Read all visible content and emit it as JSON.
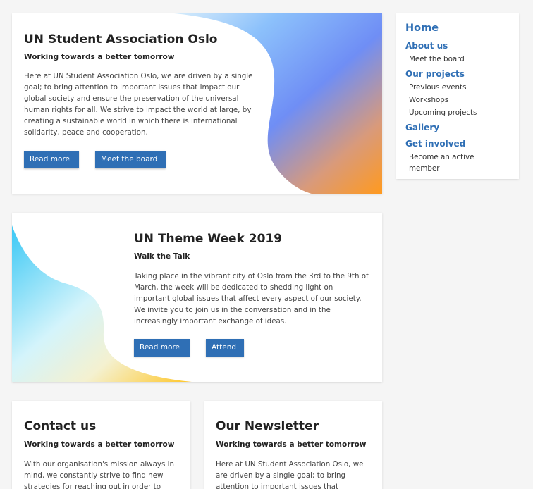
{
  "hero": {
    "title": "UN Student Association Oslo",
    "subtitle": "Working towards a better tomorrow",
    "body": "Here at UN Student Association Oslo, we are driven by a single goal; to bring attention to important issues that impact our global society and ensure the preservation of the universal human rights for all. We strive to impact the world at large, by creating a sustainable world in which there is international solidarity, peace and cooperation.",
    "btn_read_more": "Read more",
    "btn_meet_board": "Meet the board"
  },
  "theme_week": {
    "title": "UN Theme Week 2019",
    "subtitle": "Walk the Talk",
    "body": "Taking place in the vibrant city of Oslo from the 3rd to the 9th of March, the week will be dedicated to shedding light on important global issues that affect every aspect of our society. We invite you to join us in the conversation and in the increasingly important exchange of ideas.",
    "btn_read_more": "Read more",
    "btn_attend": "Attend"
  },
  "contact": {
    "title": "Contact us",
    "subtitle": "Working towards a better tomorrow",
    "body": "With our organisation's mission always in mind, we constantly strive to find new strategies for reaching out in order to"
  },
  "newsletter": {
    "title": "Our Newsletter",
    "subtitle": "Working towards a better tomorrow",
    "body": "Here at UN Student Association Oslo, we are driven by a single goal; to bring attention to important issues that"
  },
  "sidebar": {
    "home": "Home",
    "about": "About us",
    "meet_board": "Meet the board",
    "projects": "Our projects",
    "previous_events": "Previous events",
    "workshops": "Workshops",
    "upcoming_projects": "Upcoming projects",
    "gallery": "Gallery",
    "get_involved": "Get involved",
    "become_member": "Become an active member"
  },
  "colors": {
    "accent": "#2f6fb5",
    "background": "#f5f5f5"
  }
}
